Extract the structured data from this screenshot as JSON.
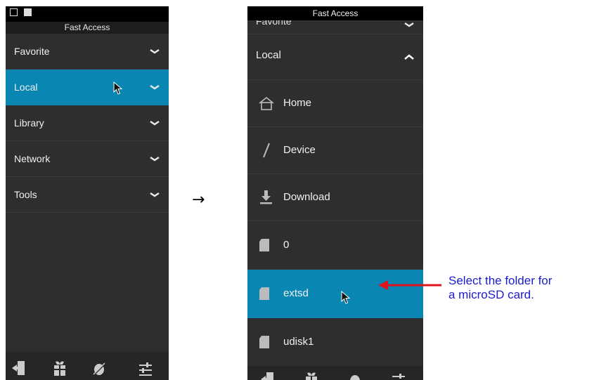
{
  "left_panel": {
    "title": "Fast Access",
    "status_icons": [
      "image-icon",
      "a-box-icon"
    ],
    "items": [
      {
        "label": "Favorite",
        "icon": "chevron-down-icon",
        "selected": false
      },
      {
        "label": "Local",
        "icon": "chevron-down-icon",
        "selected": true
      },
      {
        "label": "Library",
        "icon": "chevron-down-icon",
        "selected": false
      },
      {
        "label": "Network",
        "icon": "chevron-down-icon",
        "selected": false
      },
      {
        "label": "Tools",
        "icon": "chevron-down-icon",
        "selected": false
      }
    ],
    "bottom_icons": [
      "exit-icon",
      "gift-icon",
      "no-root-icon",
      "settings-sliders-icon"
    ]
  },
  "arrow_glyph": "→",
  "right_panel": {
    "title": "Fast Access",
    "scrolled_item": "Favorite",
    "section": {
      "label": "Local",
      "icon": "chevron-up-icon"
    },
    "items": [
      {
        "label": "Home",
        "icon": "home-icon",
        "selected": false
      },
      {
        "label": "Device",
        "icon": "slash-icon",
        "selected": false
      },
      {
        "label": "Download",
        "icon": "download-icon",
        "selected": false
      },
      {
        "label": "0",
        "icon": "sd-card-icon",
        "selected": false
      },
      {
        "label": "extsd",
        "icon": "sd-card-icon",
        "selected": true
      },
      {
        "label": "udisk1",
        "icon": "sd-card-icon",
        "selected": false
      }
    ],
    "bottom_icons": [
      "exit-icon",
      "gift-icon",
      "no-root-icon",
      "settings-sliders-icon"
    ]
  },
  "annotation": {
    "line1": "Select the folder for",
    "line2": "a microSD card.",
    "color": "#1c1ccc",
    "arrow_color": "#e0141e"
  },
  "colors": {
    "panel_bg": "#2e2e2e",
    "selected_bg": "#0a86b3",
    "text": "#f0f0f0"
  }
}
